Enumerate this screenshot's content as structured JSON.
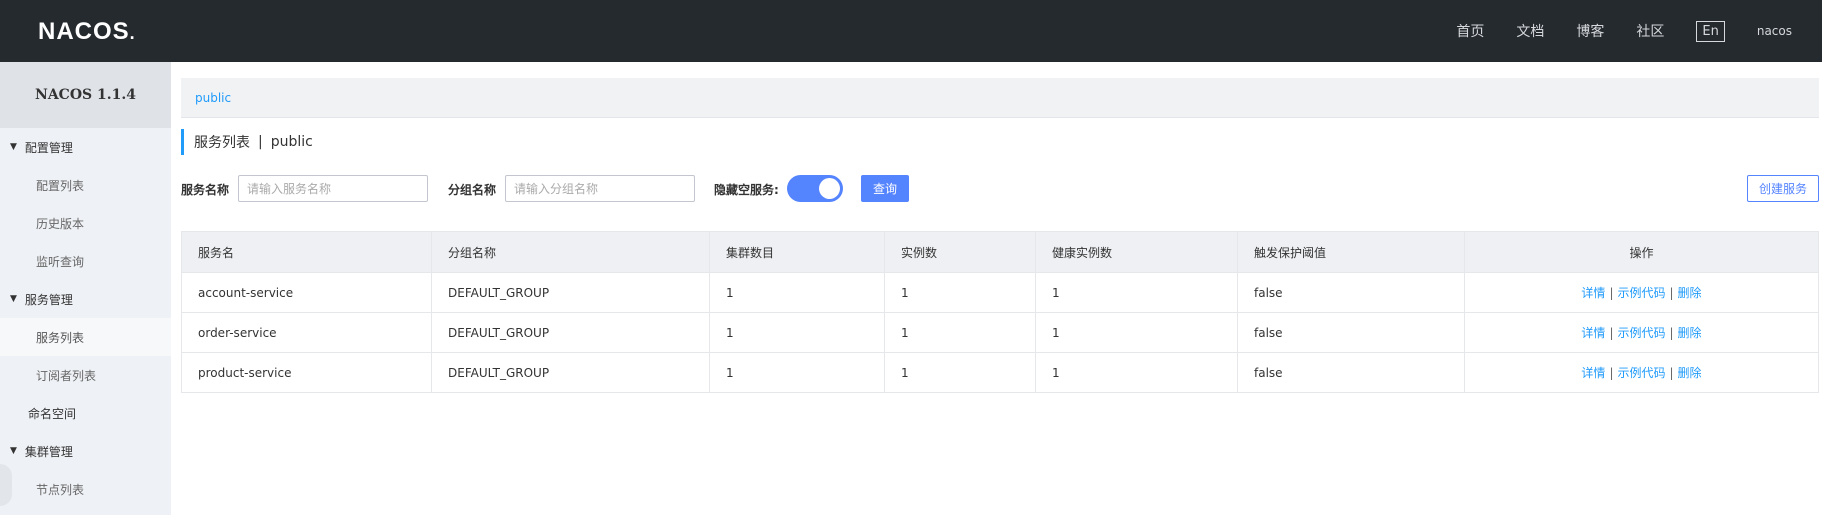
{
  "header": {
    "logo": "NACOS",
    "logo_dot": ".",
    "nav": [
      "首页",
      "文档",
      "博客",
      "社区"
    ],
    "lang": "En",
    "user": "nacos"
  },
  "sidebar": {
    "version": "NACOS 1.1.4",
    "groups": [
      {
        "label": "配置管理",
        "items": [
          "配置列表",
          "历史版本",
          "监听查询"
        ]
      },
      {
        "label": "服务管理",
        "items": [
          "服务列表",
          "订阅者列表"
        ]
      },
      {
        "label": "命名空间"
      },
      {
        "label": "集群管理",
        "items": [
          "节点列表"
        ]
      }
    ]
  },
  "breadcrumb": {
    "namespace": "public"
  },
  "page_title": {
    "title": "服务列表",
    "separator": "|",
    "namespace": "public"
  },
  "filters": {
    "service_name_label": "服务名称",
    "service_name_placeholder": "请输入服务名称",
    "group_name_label": "分组名称",
    "group_name_placeholder": "请输入分组名称",
    "hide_empty_label": "隐藏空服务:",
    "hide_empty_on": true,
    "query_label": "查询",
    "create_label": "创建服务"
  },
  "table": {
    "columns": [
      "服务名",
      "分组名称",
      "集群数目",
      "实例数",
      "健康实例数",
      "触发保护阈值",
      "操作"
    ],
    "rows": [
      [
        "account-service",
        "DEFAULT_GROUP",
        "1",
        "1",
        "1",
        "false"
      ],
      [
        "order-service",
        "DEFAULT_GROUP",
        "1",
        "1",
        "1",
        "false"
      ],
      [
        "product-service",
        "DEFAULT_GROUP",
        "1",
        "1",
        "1",
        "false"
      ]
    ],
    "ops": {
      "detail": "详情",
      "sample": "示例代码",
      "delete": "删除",
      "sep": "|"
    }
  },
  "colors": {
    "topbar": "#252a2f",
    "accent": "#5584ff",
    "link": "#209bfa",
    "sidebar": "#eef1f5"
  }
}
